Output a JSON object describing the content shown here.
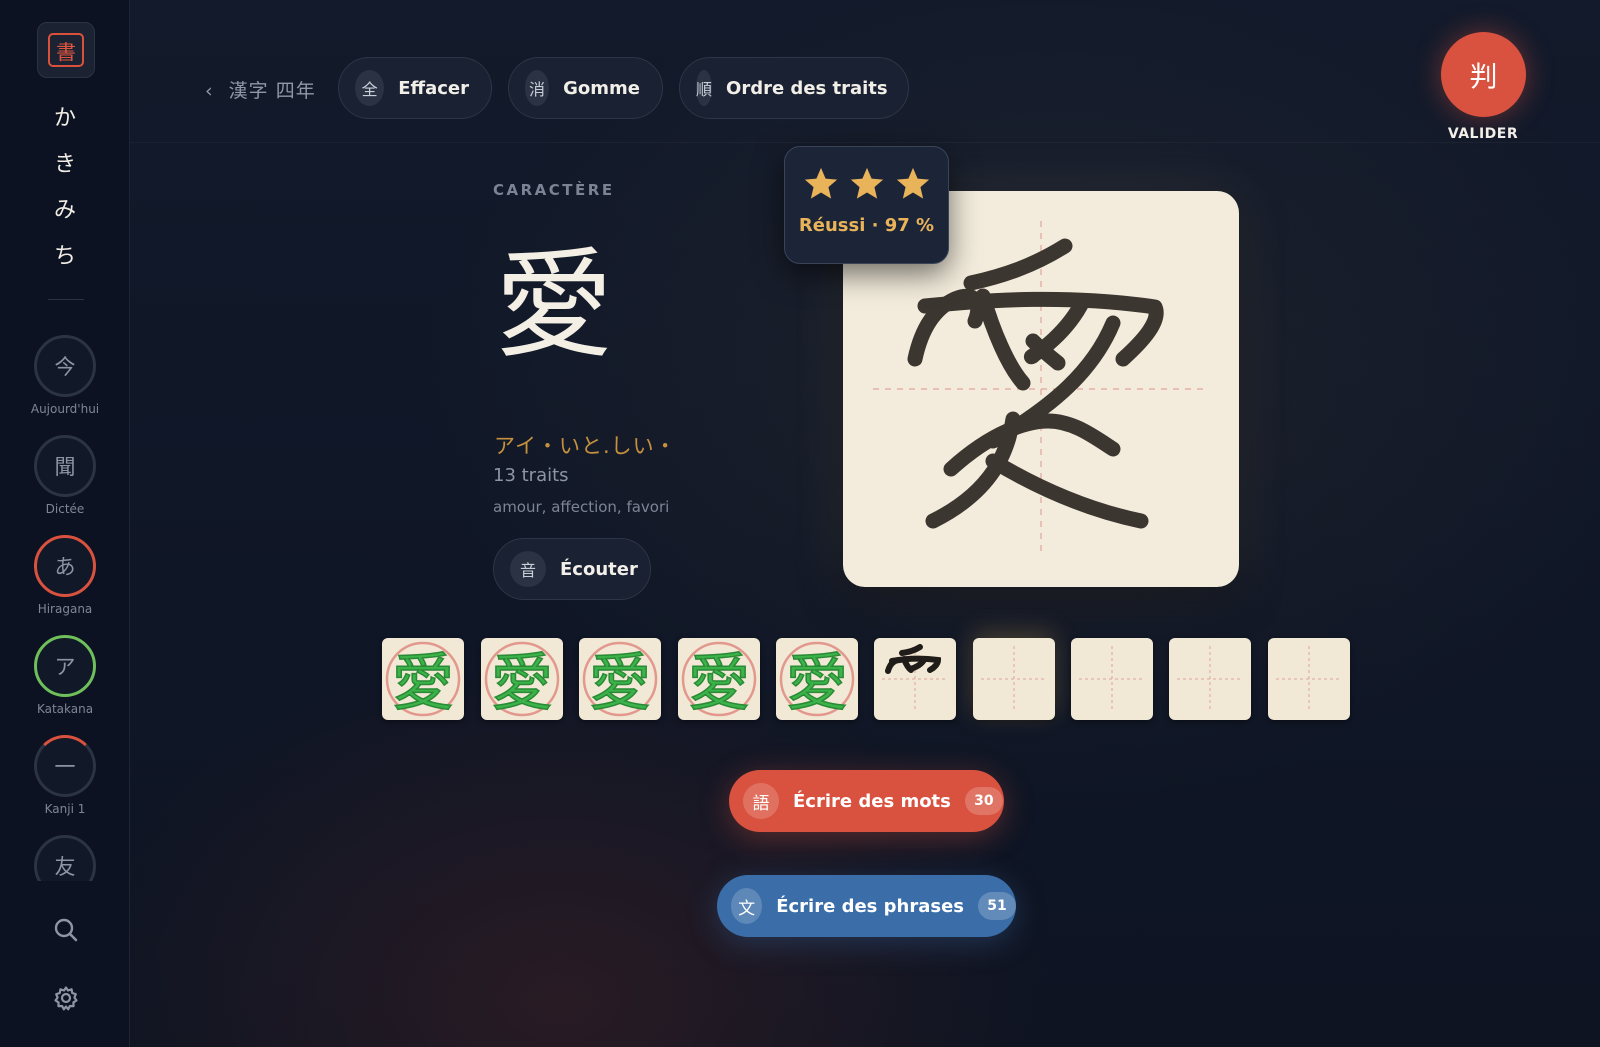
{
  "sidebar": {
    "logo_glyph": "書",
    "app_name_chars": [
      "か",
      "き",
      "み",
      "ち"
    ],
    "nav": [
      {
        "glyph": "今",
        "label": "Aujourd'hui",
        "ring": "none"
      },
      {
        "glyph": "聞",
        "label": "Dictée",
        "ring": "none"
      },
      {
        "glyph": "あ",
        "label": "Hiragana",
        "ring": "red"
      },
      {
        "glyph": "ア",
        "label": "Katakana",
        "ring": "green"
      },
      {
        "glyph": "一",
        "label": "Kanji 1",
        "ring": "partial"
      },
      {
        "glyph": "友",
        "label": "",
        "ring": "none"
      }
    ],
    "icons": [
      "search-icon",
      "gear-icon"
    ]
  },
  "toolbar": {
    "back_label": "漢字 四年",
    "buttons": [
      {
        "glyph": "全",
        "label": "Effacer"
      },
      {
        "glyph": "消",
        "label": "Gomme"
      },
      {
        "glyph": "順",
        "label": "Ordre des traits"
      }
    ],
    "validate": {
      "glyph": "判",
      "label": "VALIDER"
    }
  },
  "character": {
    "caption": "CARACTÈRE",
    "kanji": "愛",
    "readings": "アイ・いと.しい・",
    "strokes": "13 traits",
    "meaning": "amour, affection, favori",
    "listen": {
      "glyph": "音",
      "label": "Écouter"
    }
  },
  "score": {
    "stars": 3,
    "max_stars": 3,
    "text": "Réussi · 97 %"
  },
  "practice": {
    "total_cells": 10,
    "completed": 5,
    "in_progress": 1
  },
  "actions": [
    {
      "glyph": "語",
      "label": "Écrire des mots",
      "count": "30",
      "color": "#d9523f"
    },
    {
      "glyph": "文",
      "label": "Écrire des phrases",
      "count": "51",
      "color": "#3b6ea8"
    }
  ],
  "colors": {
    "accent_red": "#d9523f",
    "accent_blue": "#3b6ea8",
    "success_green": "#6fbf5b",
    "gold": "#e9b35a",
    "paper": "#f3ecdc",
    "ink": "#3b3630"
  }
}
